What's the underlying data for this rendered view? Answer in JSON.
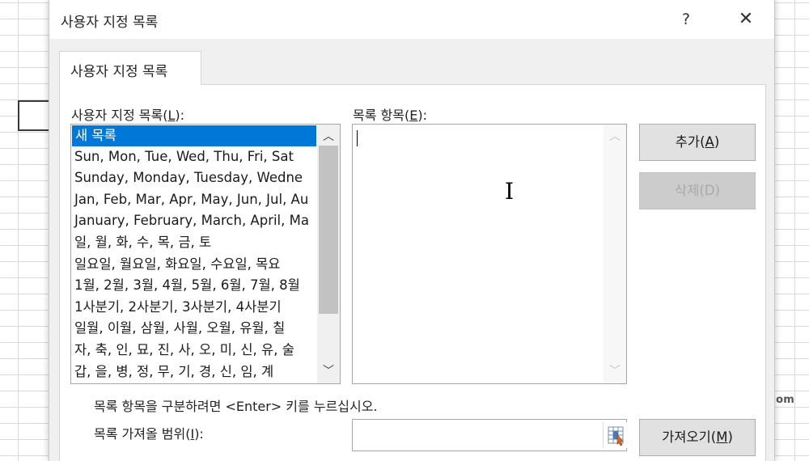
{
  "watermark": "shinyj-it.tistory.com",
  "dialog": {
    "title": "사용자 지정 목록",
    "help_label": "?",
    "close_label": "✕",
    "tab_label": "사용자 지정 목록"
  },
  "lists": {
    "label_text": "사용자 지정 목록(",
    "label_key": "L",
    "label_end": "):",
    "items": [
      "새 목록",
      "Sun, Mon, Tue, Wed, Thu, Fri, Sat",
      "Sunday, Monday, Tuesday, Wedne",
      "Jan, Feb, Mar, Apr, May, Jun, Jul, Au",
      "January, February, March, April, Ma",
      "일, 월, 화, 수, 목, 금, 토",
      "일요일, 월요일, 화요일, 수요일, 목요",
      "1월, 2월, 3월, 4월, 5월, 6월, 7월, 8월",
      "1사분기, 2사분기, 3사분기, 4사분기",
      "일월, 이월, 삼월, 사월, 오월, 유월, 칠",
      "자, 축, 인, 묘, 진, 사, 오, 미, 신, 유, 술",
      "갑, 을, 병, 정, 무, 기, 경, 신, 임, 계"
    ],
    "selected_index": 0
  },
  "entries": {
    "label_text": "목록 항목(",
    "label_key": "E",
    "label_end": "):",
    "value": ""
  },
  "buttons": {
    "add_text": "추가(",
    "add_key": "A",
    "add_end": ")",
    "delete_text": "삭제(",
    "delete_key": "D",
    "delete_end": ")",
    "import_text": "가져오기(",
    "import_key": "M",
    "import_end": ")"
  },
  "hint": "목록 항목을 구분하려면 <Enter> 키를 누르십시오.",
  "import_range": {
    "label_text": "목록 가져올 범위(",
    "label_key": "I",
    "label_end": "):",
    "value": ""
  },
  "colors": {
    "selection": "#0078d7",
    "dialog_bg": "#f0f0f0"
  }
}
